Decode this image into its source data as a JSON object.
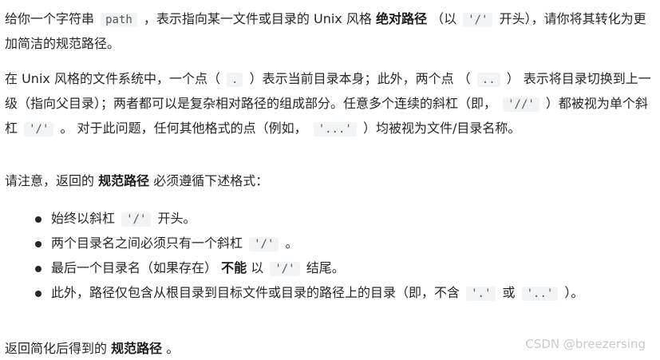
{
  "p1": {
    "t1": "给你一个字符串",
    "c1": "path",
    "t2": "，表示指向某一文件或目录的 Unix 风格",
    "b1": "绝对路径",
    "t3": "（以",
    "c2": "'/'",
    "t4": "开头），请你将其转化为更加简洁的规范路径。"
  },
  "p2": {
    "t1": "在 Unix 风格的文件系统中，一个点（",
    "c1": ".",
    "t2": "）表示当前目录本身；此外，两个点 （",
    "c2": "..",
    "t3": "） 表示将目录切换到上一级（指向父目录）；两者都可以是复杂相对路径的组成部分。任意多个连续的斜杠（即，",
    "c3": "'//'",
    "t4": "）都被视为单个斜杠",
    "c4": "'/'",
    "t5": "。 对于此问题，任何其他格式的点（例如，",
    "c5": "'...'",
    "t6": "）均被视为文件/目录名称。"
  },
  "p3": {
    "t1": "请注意，返回的",
    "b1": "规范路径",
    "t2": "必须遵循下述格式："
  },
  "list": [
    {
      "t1": "始终以斜杠",
      "c1": "'/'",
      "t2": "开头。"
    },
    {
      "t1": "两个目录名之间必须只有一个斜杠",
      "c1": "'/'",
      "t2": "。"
    },
    {
      "t1": "最后一个目录名（如果存在）",
      "b1": "不能",
      "t2": "以",
      "c1": "'/'",
      "t3": "结尾。"
    },
    {
      "t1": "此外，路径仅包含从根目录到目标文件或目录的路径上的目录（即，不含",
      "c1": "'.'",
      "t2": "或",
      "c2": "'..'",
      "t3": "）。"
    }
  ],
  "p4": {
    "t1": "返回简化后得到的",
    "b1": "规范路径",
    "t2": "。"
  },
  "watermark": "CSDN @breezersing"
}
